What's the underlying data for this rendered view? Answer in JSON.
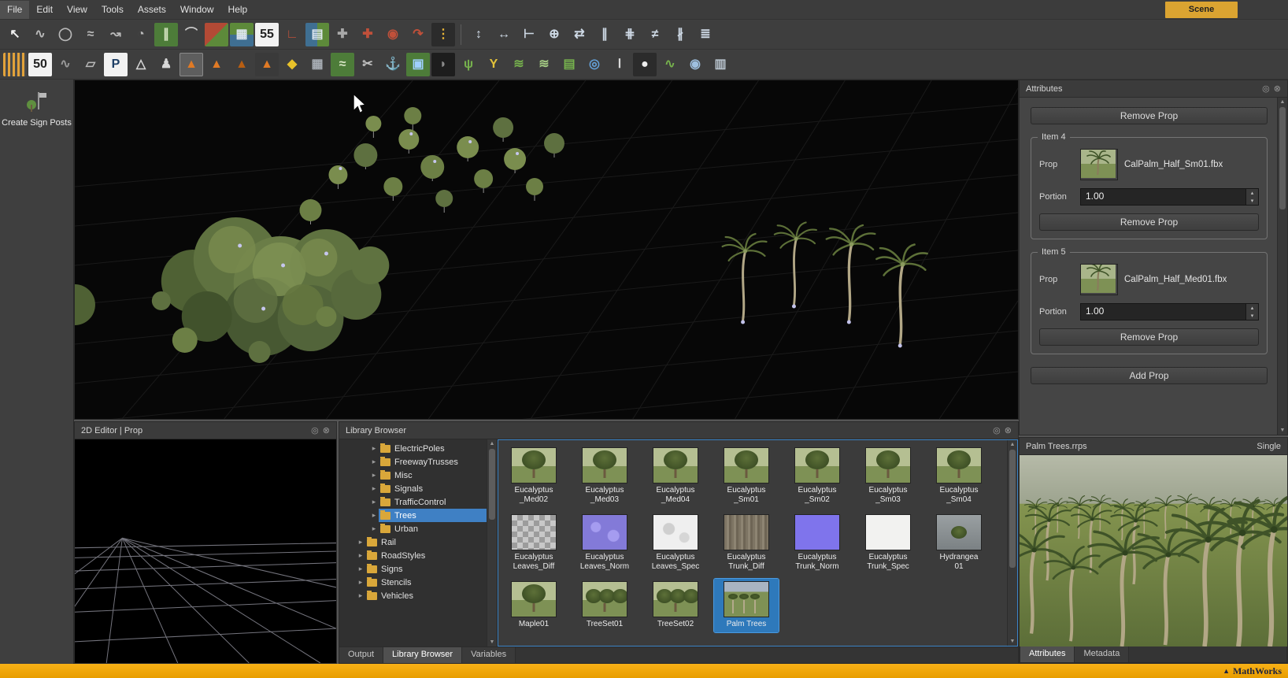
{
  "menubar": {
    "items": [
      "File",
      "Edit",
      "View",
      "Tools",
      "Assets",
      "Window",
      "Help"
    ],
    "scene_tab": "Scene"
  },
  "toolbars": {
    "row1": [
      {
        "n": "select-cursor-icon",
        "g": "↖",
        "c": "#f2f2f2"
      },
      {
        "n": "s-curve-tool-icon",
        "g": "∿",
        "c": "#b9b9b9"
      },
      {
        "n": "circle-tool-icon",
        "g": "◯",
        "c": "#b9b9b9"
      },
      {
        "n": "freeform-curve-icon",
        "g": "≈",
        "c": "#b9b9b9"
      },
      {
        "n": "spiral-curve-icon",
        "g": "↝",
        "c": "#b9b9b9"
      },
      {
        "n": "arc-protractor-icon",
        "g": "◔",
        "c": "#b9b9b9"
      },
      {
        "n": "highway-tool-icon",
        "g": "∥",
        "c": "#d9e6c5",
        "b": "#4d7c39"
      },
      {
        "n": "bridge-tool-icon",
        "g": "⌒",
        "c": "#c9c9c9"
      },
      {
        "n": "road-surface-icon",
        "g": "",
        "b": "linear-gradient(135deg,#b34a35 50%,#5d8a3a 50%)"
      },
      {
        "n": "lane-table-icon",
        "g": "▦",
        "c": "#dfe8f0",
        "b": "linear-gradient(#5d8a3a 50%,#3f6f92 50%)"
      },
      {
        "n": "speed-limit-55-icon",
        "g": "55",
        "c": "#222222",
        "b": "#f2f2f2"
      },
      {
        "n": "road-corner-icon",
        "g": "∟",
        "c": "#c0503a"
      },
      {
        "n": "city-blocks-icon",
        "g": "▤",
        "c": "#dfe8f0",
        "b": "linear-gradient(90deg,#3f6f92 50%,#5d8a3a 50%)"
      },
      {
        "n": "intersection-icon",
        "g": "✚",
        "c": "#a8a8a8"
      },
      {
        "n": "junction-red-icon",
        "g": "✚",
        "c": "#c0503a"
      },
      {
        "n": "roundabout-icon",
        "g": "◉",
        "c": "#c0503a"
      },
      {
        "n": "signal-curve-icon",
        "g": "↷",
        "c": "#c0503a"
      },
      {
        "n": "traffic-light-icon",
        "g": "⋮",
        "c": "#e8b537",
        "b": "#2b2b2b"
      },
      {
        "n": "separator"
      },
      {
        "n": "lane-width-icon",
        "g": "↕",
        "c": "#cdd8e4"
      },
      {
        "n": "road-width-icon",
        "g": "↔",
        "c": "#cdd8e4"
      },
      {
        "n": "lane-offset-icon",
        "g": "⊢",
        "c": "#cdd8e4"
      },
      {
        "n": "lane-handle-icon",
        "g": "⊕",
        "c": "#cdd8e4"
      },
      {
        "n": "lane-swap-icon",
        "g": "⇄",
        "c": "#cdd8e4"
      },
      {
        "n": "lane-parallel-icon",
        "g": "∥",
        "c": "#cdd8e4"
      },
      {
        "n": "lane-cross-section-icon",
        "g": "⋕",
        "c": "#cdd8e4"
      },
      {
        "n": "lane-mismatch-icon",
        "g": "≠",
        "c": "#cdd8e4"
      },
      {
        "n": "lane-split-icon",
        "g": "∦",
        "c": "#cdd8e4"
      },
      {
        "n": "lane-marking-icon",
        "g": "≣",
        "c": "#cdd8e4"
      }
    ],
    "row2": [
      {
        "n": "road-style-icon",
        "g": "",
        "b": "repeating-linear-gradient(90deg,#e2a23a 0 3px,#4a4a4a 3px 6px)"
      },
      {
        "n": "speed-sign-50-icon",
        "g": "50",
        "c": "#222222",
        "b": "#f2f2f2"
      },
      {
        "n": "road-segment-icon",
        "g": "∿",
        "c": "#9a9a9a"
      },
      {
        "n": "polygon-tool-icon",
        "g": "▱",
        "c": "#b9b9b9"
      },
      {
        "n": "parking-tool-icon",
        "g": "P",
        "c": "#1e3f66",
        "b": "#f2f2f2"
      },
      {
        "n": "crosswalk-tool-icon",
        "g": "△",
        "c": "#d8d8d8"
      },
      {
        "n": "pedestrian-tool-icon",
        "g": "♟",
        "c": "#d8d8d8"
      },
      {
        "n": "prop-cone-tool-icon",
        "g": "▲",
        "c": "#e07a25",
        "sel": true
      },
      {
        "n": "prop-pair-icon",
        "g": "▲",
        "c": "#e07a25"
      },
      {
        "n": "prop-cone-dark-icon",
        "g": "▲",
        "c": "#b85e12"
      },
      {
        "n": "prop-cluster-icon",
        "g": "▲",
        "c": "#e07a25",
        "b": "#3a3a3a"
      },
      {
        "n": "hazard-sign-icon",
        "g": "◆",
        "c": "#e8c22a"
      },
      {
        "n": "building-tool-icon",
        "g": "▦",
        "c": "#a8aeb5"
      },
      {
        "n": "terrain-tool-icon",
        "g": "≈",
        "c": "#d9e6c5",
        "b": "#4d7c39"
      },
      {
        "n": "repair-tool-icon",
        "g": "✂",
        "c": "#c4c4c4"
      },
      {
        "n": "anchor-tool-icon",
        "g": "⚓",
        "c": "#c4ccd4"
      },
      {
        "n": "region-tool-icon",
        "g": "▣",
        "c": "#9fd0ff",
        "b": "#4d7c39"
      },
      {
        "n": "shadow-tool-icon",
        "g": "◗",
        "c": "#8a8a8a",
        "b": "#1d1d1d"
      },
      {
        "n": "vegetation-tool-icon",
        "g": "ψ",
        "c": "#76b14d"
      },
      {
        "n": "branch-tool-icon",
        "g": "Y",
        "c": "#e2c23a"
      },
      {
        "n": "surface-layer-icon",
        "g": "≋",
        "c": "#76b14d"
      },
      {
        "n": "surface-layer-alt-icon",
        "g": "≋",
        "c": "#a5cc84"
      },
      {
        "n": "layer-stack-icon",
        "g": "▤",
        "c": "#76b14d"
      },
      {
        "n": "elevation-pin-icon",
        "g": "◎",
        "c": "#63a0d8"
      },
      {
        "n": "measure-tool-icon",
        "g": "Ⅰ",
        "c": "#d8d8d8"
      },
      {
        "n": "camera-tool-icon",
        "g": "●",
        "c": "#eeeeee",
        "b": "#2b2b2b"
      },
      {
        "n": "road-export-icon",
        "g": "∿",
        "c": "#76b14d"
      },
      {
        "n": "scene-preview-icon",
        "g": "◉",
        "c": "#9fc0e0"
      },
      {
        "n": "copy-stack-icon",
        "g": "▥",
        "c": "#b9c4ce"
      }
    ]
  },
  "sidebar": {
    "tool_label": "Create Sign Posts"
  },
  "attributes": {
    "title": "Attributes",
    "top_remove_label": "Remove Prop",
    "items": [
      {
        "group": "Item 4",
        "prop_label": "Prop",
        "file": "CalPalm_Half_Sm01.fbx",
        "portion_label": "Portion",
        "portion": "1.00",
        "remove_label": "Remove Prop"
      },
      {
        "group": "Item 5",
        "prop_label": "Prop",
        "file": "CalPalm_Half_Med01.fbx",
        "portion_label": "Portion",
        "portion": "1.00",
        "remove_label": "Remove Prop"
      }
    ],
    "add_label": "Add Prop"
  },
  "editor2d": {
    "title": "2D Editor | Prop"
  },
  "library": {
    "title": "Library Browser",
    "tree_items": [
      {
        "label": "ElectricPoles",
        "indent": 2
      },
      {
        "label": "FreewayTrusses",
        "indent": 2
      },
      {
        "label": "Misc",
        "indent": 2
      },
      {
        "label": "Signals",
        "indent": 2
      },
      {
        "label": "TrafficControl",
        "indent": 2
      },
      {
        "label": "Trees",
        "indent": 2,
        "selected": true
      },
      {
        "label": "Urban",
        "indent": 2
      },
      {
        "label": "Rail",
        "indent": 1
      },
      {
        "label": "RoadStyles",
        "indent": 1
      },
      {
        "label": "Signs",
        "indent": 1
      },
      {
        "label": "Stencils",
        "indent": 1
      },
      {
        "label": "Vehicles",
        "indent": 1
      }
    ],
    "assets": [
      {
        "label": "Eucalyptus\n_Med02",
        "kind": "tree"
      },
      {
        "label": "Eucalyptus\n_Med03",
        "kind": "tree"
      },
      {
        "label": "Eucalyptus\n_Med04",
        "kind": "tree"
      },
      {
        "label": "Eucalyptus\n_Sm01",
        "kind": "tree"
      },
      {
        "label": "Eucalyptus\n_Sm02",
        "kind": "tree"
      },
      {
        "label": "Eucalyptus\n_Sm03",
        "kind": "tree"
      },
      {
        "label": "Eucalyptus\n_Sm04",
        "kind": "tree"
      },
      {
        "label": "Eucalyptus\nLeaves_Diff",
        "kind": "checker"
      },
      {
        "label": "Eucalyptus\nLeaves_Norm",
        "kind": "norm-leaves"
      },
      {
        "label": "Eucalyptus\nLeaves_Spec",
        "kind": "spec-leaves"
      },
      {
        "label": "Eucalyptus\nTrunk_Diff",
        "kind": "bark"
      },
      {
        "label": "Eucalyptus\nTrunk_Norm",
        "kind": "norm-solid"
      },
      {
        "label": "Eucalyptus\nTrunk_Spec",
        "kind": "spec-solid"
      },
      {
        "label": "Hydrangea\n01",
        "kind": "hydrangea"
      },
      {
        "label": "Maple01",
        "kind": "tree"
      },
      {
        "label": "TreeSet01",
        "kind": "treeset"
      },
      {
        "label": "TreeSet02",
        "kind": "treeset"
      },
      {
        "label": "Palm Trees",
        "kind": "palms",
        "selected": true
      }
    ],
    "dock_tabs": [
      {
        "label": "Output"
      },
      {
        "label": "Library Browser",
        "active": true
      },
      {
        "label": "Variables"
      }
    ]
  },
  "preview": {
    "title": "Palm Trees.rrps",
    "mode": "Single",
    "tabs": [
      {
        "label": "Attributes",
        "active": true
      },
      {
        "label": "Metadata"
      }
    ]
  },
  "statusbar": {
    "brand": "MathWorks"
  },
  "colors": {
    "accent_selection": "#3f80c4",
    "asset_selection": "#2e79bb",
    "scene_tab": "#dba431",
    "status_bar": "#f2a70b",
    "folder": "#d9a73a"
  }
}
